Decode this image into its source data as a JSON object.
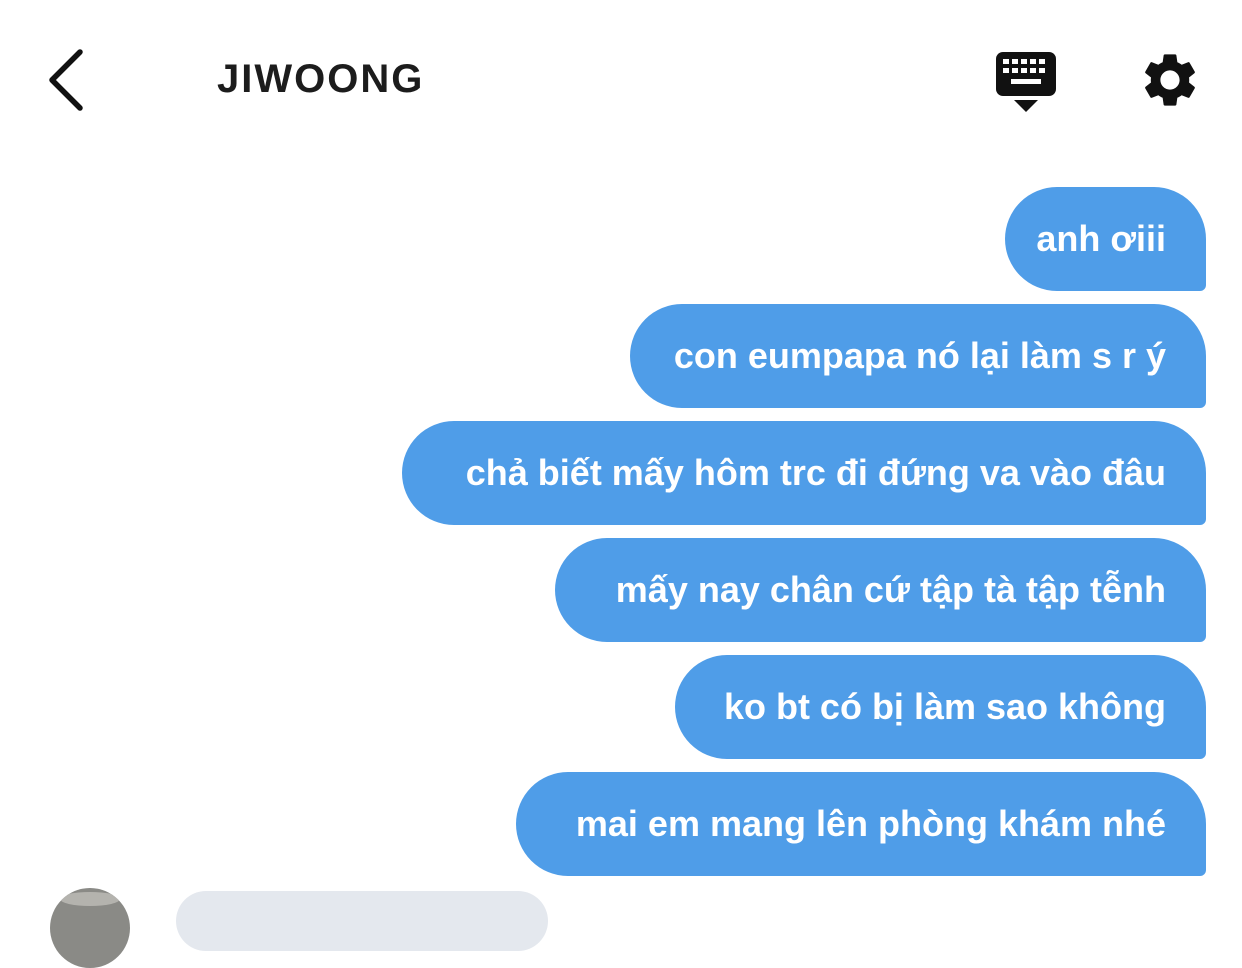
{
  "header": {
    "title": "JIWOONG",
    "back_icon": "chevron-left-icon",
    "keyboard_icon": "keyboard-hide-icon",
    "settings_icon": "gear-icon"
  },
  "messages": [
    {
      "sender": "me",
      "text": "anh ơiii"
    },
    {
      "sender": "me",
      "text": "con eumpapa nó lại làm s r ý"
    },
    {
      "sender": "me",
      "text": "chả biết mấy hôm trc đi đứng va vào đâu"
    },
    {
      "sender": "me",
      "text": "mấy nay chân cứ tập tà tập tễnh"
    },
    {
      "sender": "me",
      "text": "ko bt có bị làm sao không"
    },
    {
      "sender": "me",
      "text": "mai em mang lên phòng khám nhé"
    }
  ],
  "colors": {
    "outgoing_bubble": "#4f9de8",
    "outgoing_text": "#ffffff",
    "incoming_bubble": "#e4e8ee",
    "title": "#1c1c1c",
    "background": "#ffffff"
  }
}
